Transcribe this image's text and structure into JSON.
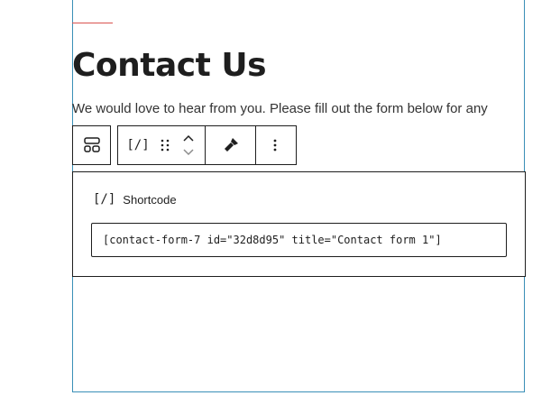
{
  "page": {
    "title": "Contact Us",
    "intro": "We would love to hear from you. Please fill out the form below for any"
  },
  "toolbar": {
    "parent_icon": "layout-grid-icon",
    "block_type_icon": "shortcode-icon",
    "block_type_glyph": "[/]",
    "drag_icon": "drag-handle-icon",
    "move_up_icon": "chevron-up-icon",
    "move_down_icon": "chevron-down-icon",
    "tool_icon": "paint-brush-icon",
    "more_icon": "vertical-ellipsis-icon"
  },
  "shortcode_block": {
    "label": "Shortcode",
    "icon_glyph": "[/]",
    "value": "[contact-form-7 id=\"32d8d95\" title=\"Contact form 1\"]"
  },
  "colors": {
    "accent_line": "#d9534f",
    "frame_border": "#3a8fb7",
    "text": "#1e1e1e"
  }
}
